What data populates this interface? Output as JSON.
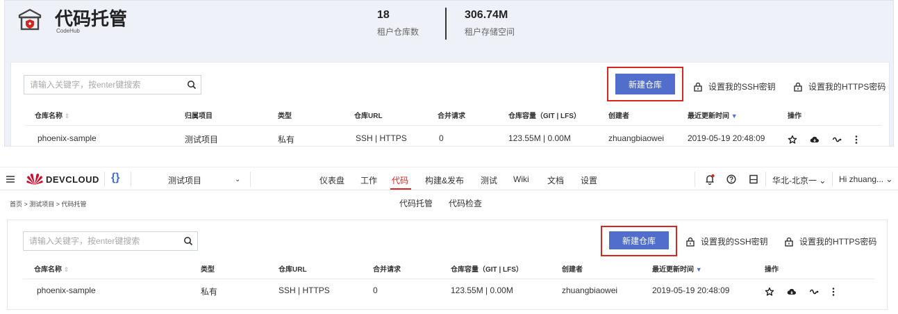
{
  "codehub": {
    "title": "代码托管",
    "subtitle": "CodeHub",
    "stats": [
      {
        "value": "18",
        "label": "租户仓库数"
      },
      {
        "value": "306.74M",
        "label": "租户存储空间"
      }
    ]
  },
  "toolbar": {
    "search_placeholder": "请输入关键字，按enter键搜索",
    "new_repo_label": "新建仓库",
    "ssh_key_label": "设置我的SSH密钥",
    "https_key_label": "设置我的HTTPS密码"
  },
  "table_top": {
    "headers": [
      "仓库名称",
      "归属项目",
      "类型",
      "仓库URL",
      "合并请求",
      "仓库容量（GIT | LFS）",
      "创建者",
      "最近更新时间",
      "操作"
    ],
    "rows": [
      [
        "phoenix-sample",
        "测试项目",
        "私有",
        "SSH | HTTPS",
        "0",
        "123.55M | 0.00M",
        "zhuangbiaowei",
        "2019-05-19 20:48:09"
      ]
    ]
  },
  "navbar": {
    "brand": "DEVCLOUD",
    "project": "测试项目",
    "items": [
      "仪表盘",
      "工作",
      "代码",
      "构建&发布",
      "测试",
      "Wiki",
      "文档",
      "设置"
    ],
    "active_item": "代码",
    "region": "华北-北京一",
    "user": "Hi zhuang..."
  },
  "breadcrumb": "首页 > 测试项目 > 代码托管",
  "subtabs": [
    "代码托管",
    "代码检查"
  ],
  "table_bottom": {
    "headers": [
      "仓库名称",
      "类型",
      "仓库URL",
      "合并请求",
      "仓库容量（GIT | LFS）",
      "创建者",
      "最近更新时间",
      "操作"
    ],
    "rows": [
      [
        "phoenix-sample",
        "私有",
        "SSH | HTTPS",
        "0",
        "123.55M | 0.00M",
        "zhuangbiaowei",
        "2019-05-19 20:48:09"
      ]
    ]
  },
  "colors": {
    "accent": "#d7261f",
    "primary_button": "#526ecc",
    "huawei_red": "#cf0a2c",
    "panel_bg": "#eef1f7"
  }
}
